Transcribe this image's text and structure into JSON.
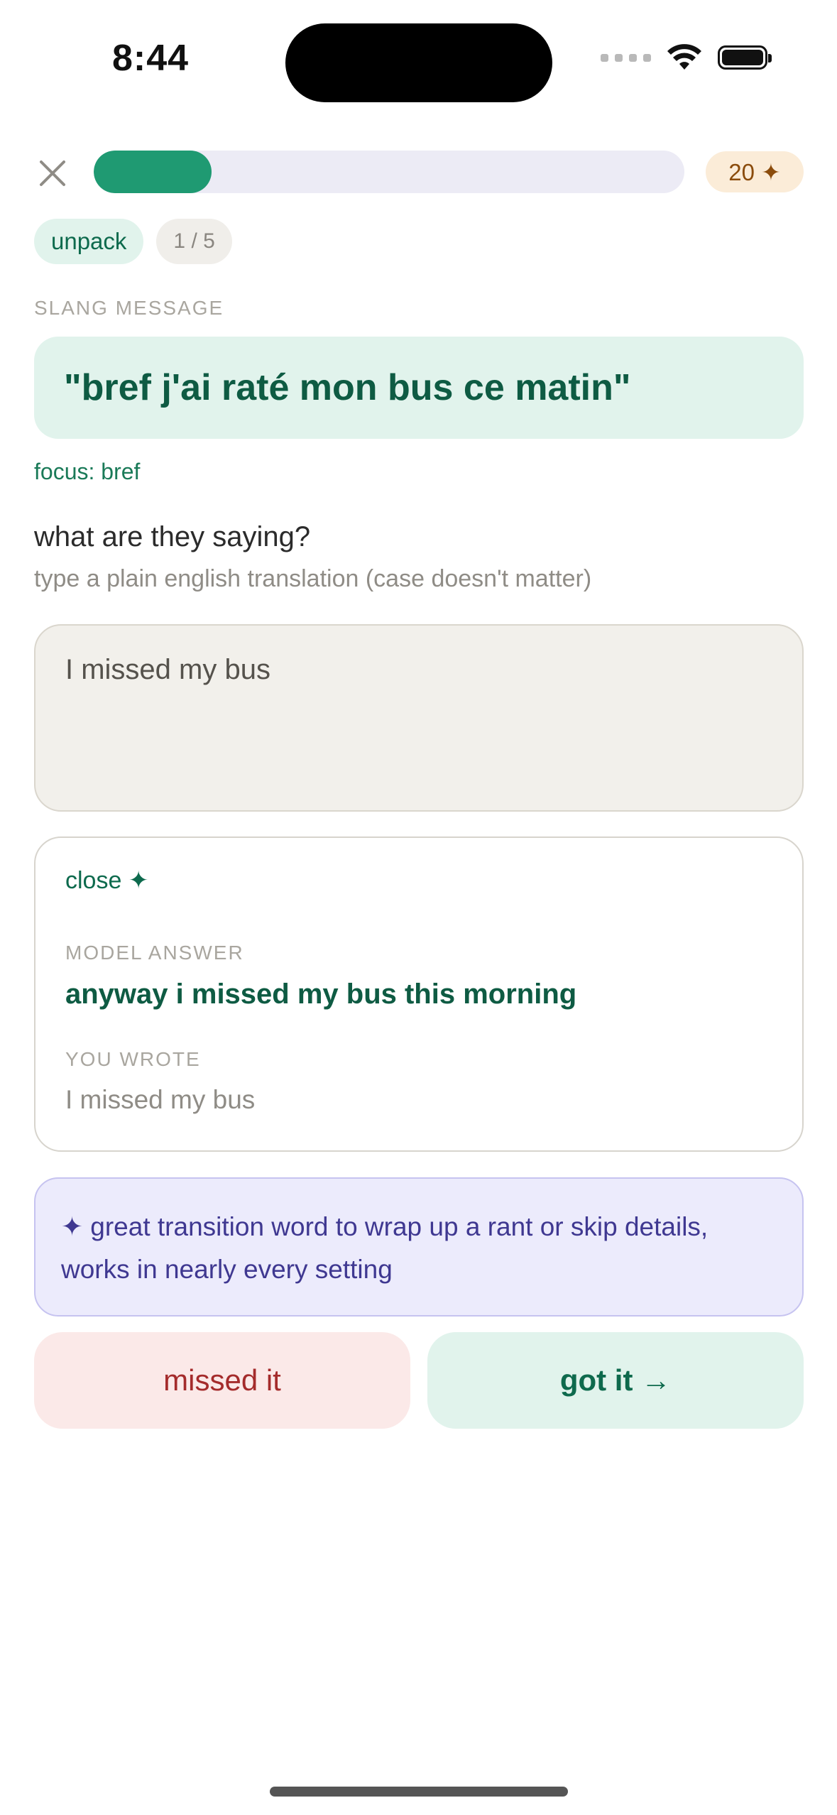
{
  "status_bar": {
    "time": "8:44"
  },
  "header": {
    "progress_fraction": 0.2,
    "points": "20 ✦",
    "colors": {
      "progress_fill": "#1f9a72",
      "progress_track": "#ecebf5",
      "points_bg": "#fbecd8"
    }
  },
  "tags": {
    "mode": "unpack",
    "count": "1 / 5"
  },
  "slang": {
    "label": "SLANG MESSAGE",
    "message": "\"bref j'ai raté mon bus ce matin\"",
    "focus": "focus: bref"
  },
  "prompt": {
    "question": "what are they saying?",
    "hint": "type a plain english translation (case doesn't matter)"
  },
  "answer": {
    "value": "I missed my bus"
  },
  "result": {
    "verdict": "close ✦",
    "model_label": "MODEL ANSWER",
    "model_answer": "anyway i missed my bus this morning",
    "wrote_label": "YOU WROTE",
    "you_wrote": "I missed my bus"
  },
  "tip": {
    "text": "✦ great transition word to wrap up a rant or skip details, works in nearly every setting"
  },
  "actions": {
    "missed": "missed it",
    "got": "got it →"
  },
  "icons": {
    "close": "close-icon",
    "wifi": "wifi-icon",
    "battery": "battery-icon",
    "signal": "signal-icon"
  }
}
